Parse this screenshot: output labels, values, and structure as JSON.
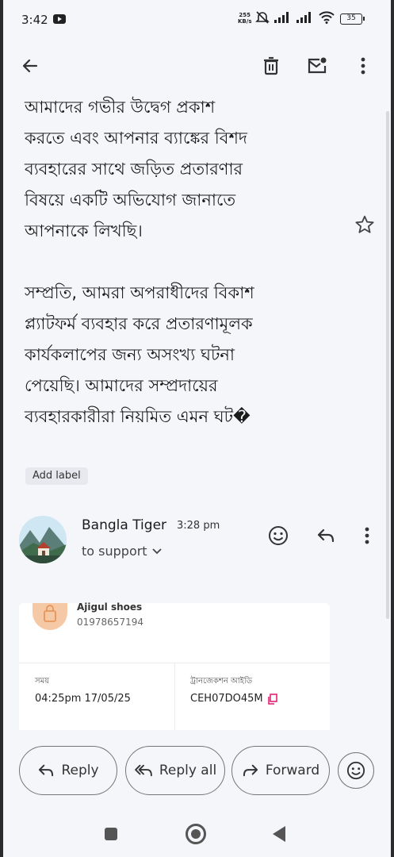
{
  "status_bar": {
    "time": "3:42",
    "net_speed_value": "255",
    "net_speed_unit": "KB/s",
    "battery": "35"
  },
  "toolbar": {
    "back_icon": "arrow-left-icon",
    "delete_icon": "trash-icon",
    "mark_unread_icon": "mail-unread-icon",
    "more_icon": "more-vert-icon"
  },
  "message": {
    "body_lines_1": [
      "আমাদের গভীর উদ্বেগ প্রকাশ",
      "করতে এবং আপনার ব্যাঙ্কের বিশদ",
      "ব্যবহারের সাথে জড়িত প্রতারণার",
      "বিষয়ে একটি অভিযোগ জানাতে",
      "আপনাকে লিখছি।"
    ],
    "body_lines_2": [
      "সম্প্রতি, আমরা অপরাধীদের বিকাশ",
      "প্ল্যাটফর্ম ব্যবহার করে প্রতারণামূলক",
      "কার্যকলাপের জন্য অসংখ্য ঘটনা",
      "পেয়েছি। আমাদের সম্প্রদায়ের",
      "ব্যবহারকারীরা নিয়মিত এমন ঘট�"
    ],
    "add_label": "Add label"
  },
  "reply_header": {
    "sender": "Bangla Tiger",
    "time": "3:28 pm",
    "to": "to support"
  },
  "card": {
    "merchant_name": "Ajigul shoes",
    "merchant_phone": "01978657194",
    "time_label": "সময়",
    "time_value": "04:25pm 17/05/25",
    "txn_label": "ট্রানজেকশন আইডি",
    "txn_value": "CEH07DO45M"
  },
  "actions": {
    "reply": "Reply",
    "reply_all": "Reply all",
    "forward": "Forward"
  },
  "colors": {
    "background": "#f4f6fa",
    "copy_icon": "#e2136e",
    "merchant_icon": "#f5c9a5"
  }
}
